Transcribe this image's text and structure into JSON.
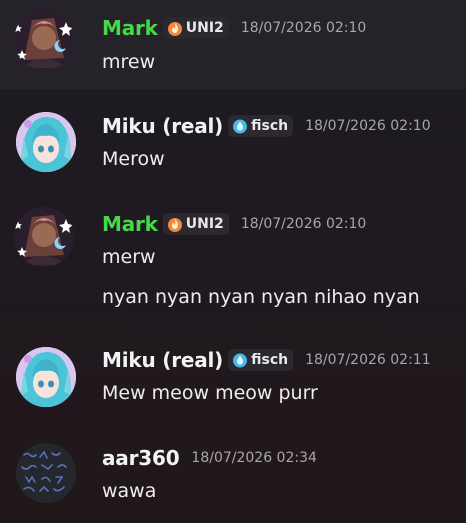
{
  "colors": {
    "mark_name": "#46d846",
    "default_name": "#f2f3f5",
    "uni2_badge": "#f0883e",
    "fisch_badge": "#49b8ea"
  },
  "messages": [
    {
      "author": "Mark",
      "tag": "UNI2",
      "tag_icon": "fire-icon",
      "timestamp": "18/07/2026 02:10",
      "lines": [
        "mrew"
      ]
    },
    {
      "author": "Miku (real)",
      "tag": "fisch",
      "tag_icon": "water-drop-icon",
      "timestamp": "18/07/2026 02:10",
      "lines": [
        "Merow"
      ]
    },
    {
      "author": "Mark",
      "tag": "UNI2",
      "tag_icon": "fire-icon",
      "timestamp": "18/07/2026 02:10",
      "lines": [
        "merw",
        "nyan nyan nyan nyan nihao nyan"
      ]
    },
    {
      "author": "Miku (real)",
      "tag": "fisch",
      "tag_icon": "water-drop-icon",
      "timestamp": "18/07/2026 02:11",
      "lines": [
        "Mew meow meow purr"
      ]
    },
    {
      "author": "aar360",
      "timestamp": "18/07/2026 02:34",
      "lines": [
        "wawa"
      ]
    }
  ]
}
